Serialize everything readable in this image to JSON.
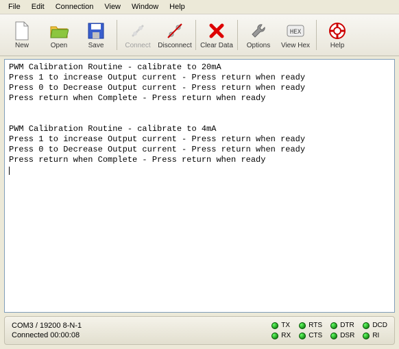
{
  "menu": {
    "file": "File",
    "edit": "Edit",
    "connection": "Connection",
    "view": "View",
    "window": "Window",
    "help": "Help"
  },
  "toolbar": {
    "new": "New",
    "open": "Open",
    "save": "Save",
    "connect": "Connect",
    "disconnect": "Disconnect",
    "clear_data": "Clear Data",
    "options": "Options",
    "view_hex": "View Hex",
    "help": "Help"
  },
  "terminal": {
    "lines": [
      "PWM Calibration Routine - calibrate to 20mA",
      "Press 1 to increase Output current - Press return when ready",
      "Press 0 to Decrease Output current - Press return when ready",
      "Press return when Complete - Press return when ready",
      "",
      "",
      "PWM Calibration Routine - calibrate to 4mA",
      "Press 1 to increase Output current - Press return when ready",
      "Press 0 to Decrease Output current - Press return when ready",
      "Press return when Complete - Press return when ready"
    ]
  },
  "status": {
    "port": "COM3 / 19200 8-N-1",
    "connected": "Connected 00:00:08",
    "leds": {
      "tx": "TX",
      "rts": "RTS",
      "dtr": "DTR",
      "dcd": "DCD",
      "rx": "RX",
      "cts": "CTS",
      "dsr": "DSR",
      "ri": "RI"
    }
  }
}
